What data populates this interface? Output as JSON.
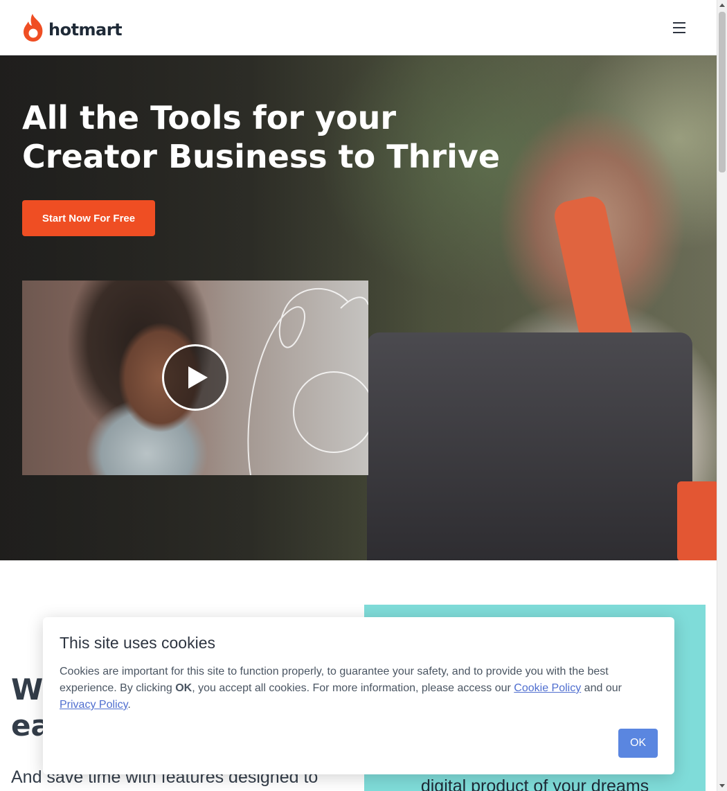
{
  "header": {
    "brand": "hotmart",
    "brand_color": "#ef4e23",
    "menu_icon": "hamburger-menu-icon"
  },
  "hero": {
    "title": "All the Tools for your Creator Business to Thrive",
    "cta_label": "Start Now For Free",
    "cta_color": "#ef4e23",
    "video_icon": "play-icon"
  },
  "section": {
    "heading": "W\nea",
    "subheading": "And save time with features designed to",
    "panel_text": "digital product of your dreams",
    "panel_color": "#7fdcd9"
  },
  "cookie": {
    "title": "This site uses cookies",
    "text_before": "Cookies are important for this site to function properly, to guarantee your safety, and to provide you with the best experience. By clicking ",
    "text_bold": "OK",
    "text_middle": ", you accept all cookies. For more information, please access our ",
    "cookie_policy_link": "Cookie Policy",
    "text_and": " and our ",
    "privacy_policy_link": "Privacy Policy",
    "text_end": ".",
    "ok_label": "OK",
    "ok_color": "#5a86e0"
  }
}
